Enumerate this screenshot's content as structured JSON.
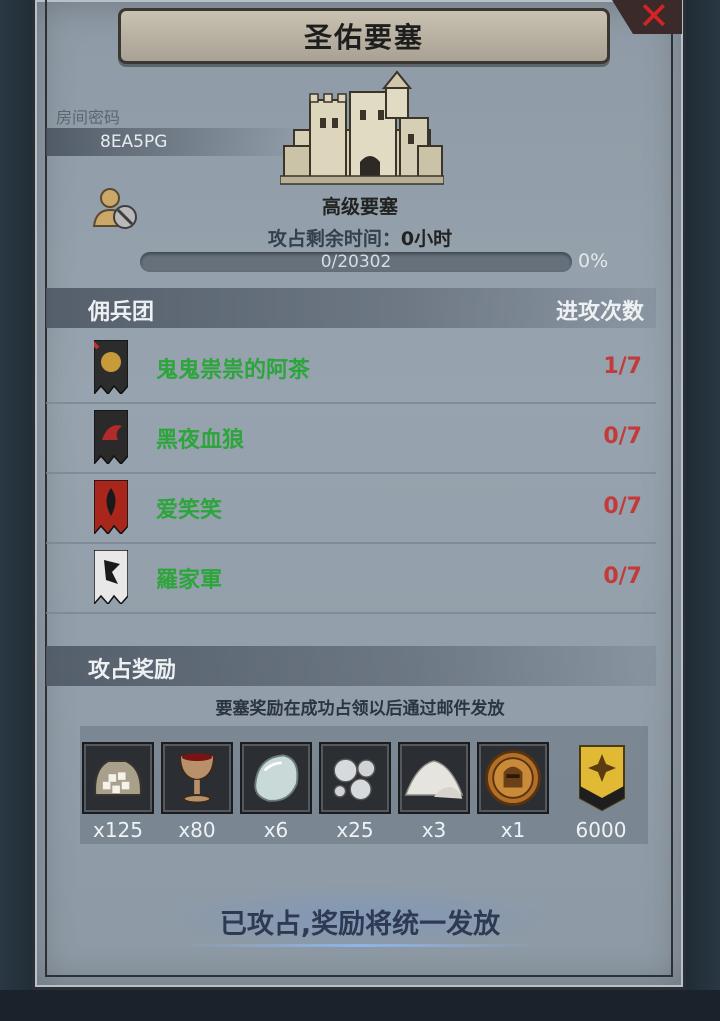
{
  "title": "圣佑要塞",
  "room": {
    "label": "房间密码",
    "code": "8EA5PG"
  },
  "fortress": {
    "level": "高级要塞",
    "time_label": "攻占剩余时间：",
    "time_value": "0小时",
    "progress_text": "0/20302",
    "progress_fraction": 0,
    "progress_pct": "0%"
  },
  "mercenary_header": {
    "title": "佣兵团",
    "right": "进攻次数"
  },
  "mercenaries": [
    {
      "name": "鬼鬼祟祟的阿茶",
      "count": "1/7",
      "banner_color": "#2c2c2c",
      "emblem_color": "#c79a3a"
    },
    {
      "name": "黑夜血狼",
      "count": "0/7",
      "banner_color": "#2a2a2a",
      "emblem_color": "#b32a2a"
    },
    {
      "name": "爱笑笑",
      "count": "0/7",
      "banner_color": "#a8261c",
      "emblem_color": "#1a1a1a"
    },
    {
      "name": "羅家軍",
      "count": "0/7",
      "banner_color": "#e8e8e8",
      "emblem_color": "#1a1a1a"
    }
  ],
  "reward_header": {
    "title": "攻占奖励"
  },
  "reward_note": "要塞奖励在成功占领以后通过邮件发放",
  "rewards": [
    {
      "icon": "sugar-sack-icon",
      "count": "x125"
    },
    {
      "icon": "goblet-icon",
      "count": "x80"
    },
    {
      "icon": "moonstone-icon",
      "count": "x6"
    },
    {
      "icon": "pearls-icon",
      "count": "x25"
    },
    {
      "icon": "salt-pile-icon",
      "count": "x3"
    },
    {
      "icon": "knight-medal-icon",
      "count": "x1"
    },
    {
      "icon": "gold-badge-icon",
      "count": "6000"
    }
  ],
  "claim_text": "已攻占,奖励将统一发放"
}
